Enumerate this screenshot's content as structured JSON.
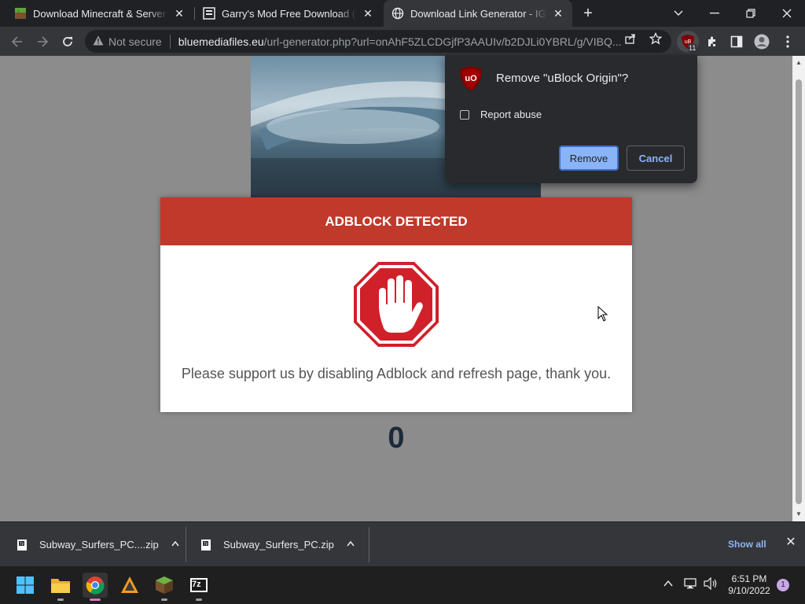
{
  "browser": {
    "tabs": [
      {
        "title": "Download Minecraft & Server Software",
        "favicon": "minecraft-grass-icon",
        "active": false
      },
      {
        "title": "Garry's Mod Free Download (Latest)",
        "favicon": "igggames-icon",
        "active": false
      },
      {
        "title": "Download Link Generator - IGGGAMES",
        "favicon": "globe-icon",
        "active": true
      }
    ],
    "new_tab_symbol": "+",
    "address": {
      "security_label": "Not secure",
      "host": "bluemediafiles.eu",
      "path": "/url-generator.php?url=onAhF5ZLCDGjfP3AAUIv/b2DJLi0YBRL/g/VIBQ..."
    },
    "ublock_badge": "11"
  },
  "uninstall_dialog": {
    "title": "Remove \"uBlock Origin\"?",
    "checkbox_label": "Report abuse",
    "remove_label": "Remove",
    "cancel_label": "Cancel"
  },
  "page": {
    "modal_title": "ADBLOCK DETECTED",
    "message": "Please support us by disabling Adblock and refresh page, thank you.",
    "counter": "0",
    "colors": {
      "header": "#c0392b",
      "stop_sign": "#d0202a"
    }
  },
  "downloads": {
    "items": [
      {
        "filename": "Subway_Surfers_PC....zip"
      },
      {
        "filename": "Subway_Surfers_PC.zip"
      }
    ],
    "show_all_label": "Show all"
  },
  "taskbar": {
    "apps": [
      "windows-start-icon",
      "file-explorer-icon",
      "chrome-icon",
      "app-icon",
      "minecraft-icon",
      "7zip-icon"
    ],
    "seven_zip_label": "7z",
    "time": "6:51 PM",
    "date": "9/10/2022",
    "notification_count": "1"
  }
}
